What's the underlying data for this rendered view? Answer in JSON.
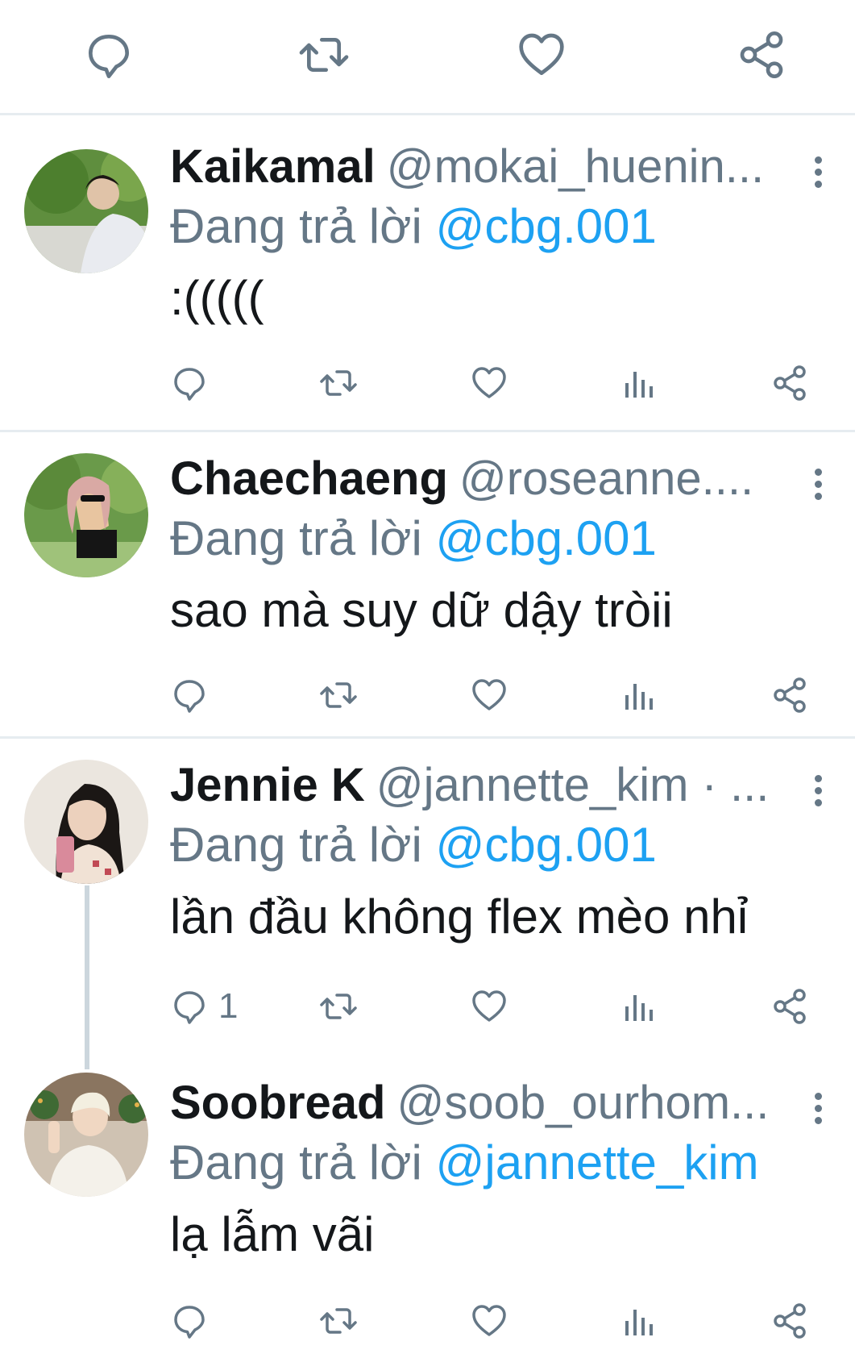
{
  "top_actions": [
    {
      "icon": "reply-icon"
    },
    {
      "icon": "retweet-icon"
    },
    {
      "icon": "like-icon"
    },
    {
      "icon": "share-icon"
    }
  ],
  "colors": {
    "text": "#14171a",
    "secondary": "#657786",
    "mention": "#1da1f2",
    "divider": "#e6ecf0"
  },
  "tweets": [
    {
      "name": "Kaikamal",
      "handle": "@mokai_huenin...",
      "reply_prefix": "Đang trả lời",
      "reply_mention": "@cbg.001",
      "text": ":(((((",
      "reply_count": ""
    },
    {
      "name": "Chaechaeng",
      "handle": "@roseanne....",
      "reply_prefix": "Đang trả lời",
      "reply_mention": "@cbg.001",
      "text": "sao mà suy dữ dậy tròii",
      "reply_count": ""
    },
    {
      "name": "Jennie K",
      "handle": "@jannette_kim · ...",
      "reply_prefix": "Đang trả lời",
      "reply_mention": "@cbg.001",
      "text": "lần đầu không flex mèo nhỉ",
      "reply_count": "1"
    },
    {
      "name": "Soobread",
      "handle": "@soob_ourhom...",
      "reply_prefix": "Đang trả lời",
      "reply_mention": "@jannette_kim",
      "text": "lạ lẫm vãi",
      "reply_count": ""
    }
  ]
}
